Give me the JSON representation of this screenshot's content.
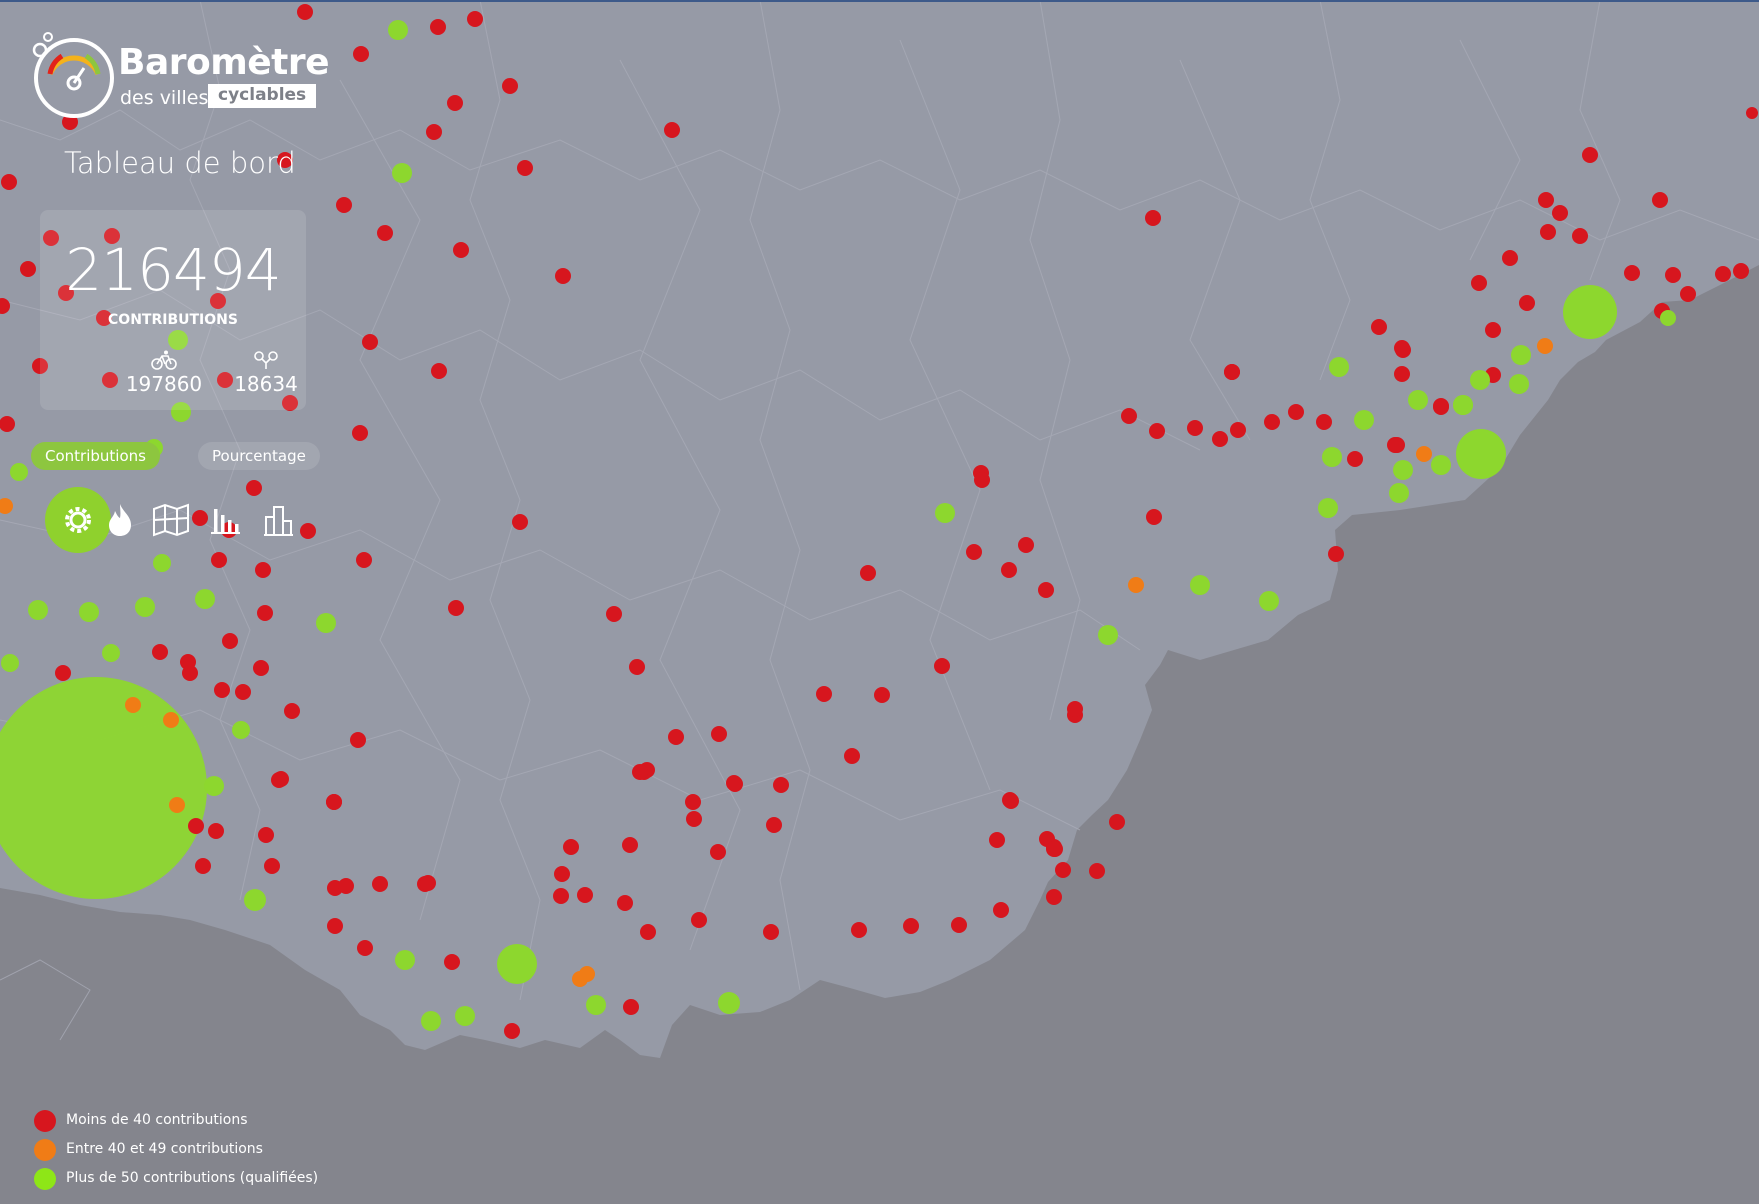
{
  "app": {
    "logo_title": "Baromètre",
    "logo_subtitle": "des villes",
    "logo_badge": "cyclables"
  },
  "dashboard": {
    "title": "Tableau de bord",
    "total": "216494",
    "total_label": "CONTRIBUTIONS",
    "cyclists": "197860",
    "cyclists_icon": "cyclist-icon",
    "non_cyclists": "18634",
    "non_cyclists_icon": "no-bike-icon"
  },
  "toggles": {
    "contributions": "Contributions",
    "percentage": "Pourcentage"
  },
  "views": [
    {
      "name": "markers-view",
      "icon": "gear-icon",
      "active": true
    },
    {
      "name": "heatmap-view",
      "icon": "flame-icon",
      "active": false
    },
    {
      "name": "regions-view",
      "icon": "map-icon",
      "active": false
    },
    {
      "name": "ranking-view",
      "icon": "bar-chart-icon",
      "active": false
    },
    {
      "name": "cities-view",
      "icon": "city-icon",
      "active": false
    }
  ],
  "legend": [
    {
      "label": "Moins de 40 contributions",
      "color": "#d7161e"
    },
    {
      "label": "Entre 40 et 49 contributions",
      "color": "#f07c16"
    },
    {
      "label": "Plus de 50 contributions (qualifiées)",
      "color": "#8ee617"
    }
  ],
  "colors": {
    "land": "#969aa6",
    "sea": "#84858d",
    "red": "#d7161e",
    "orange": "#f07c16",
    "green": "#8dd72e"
  }
}
